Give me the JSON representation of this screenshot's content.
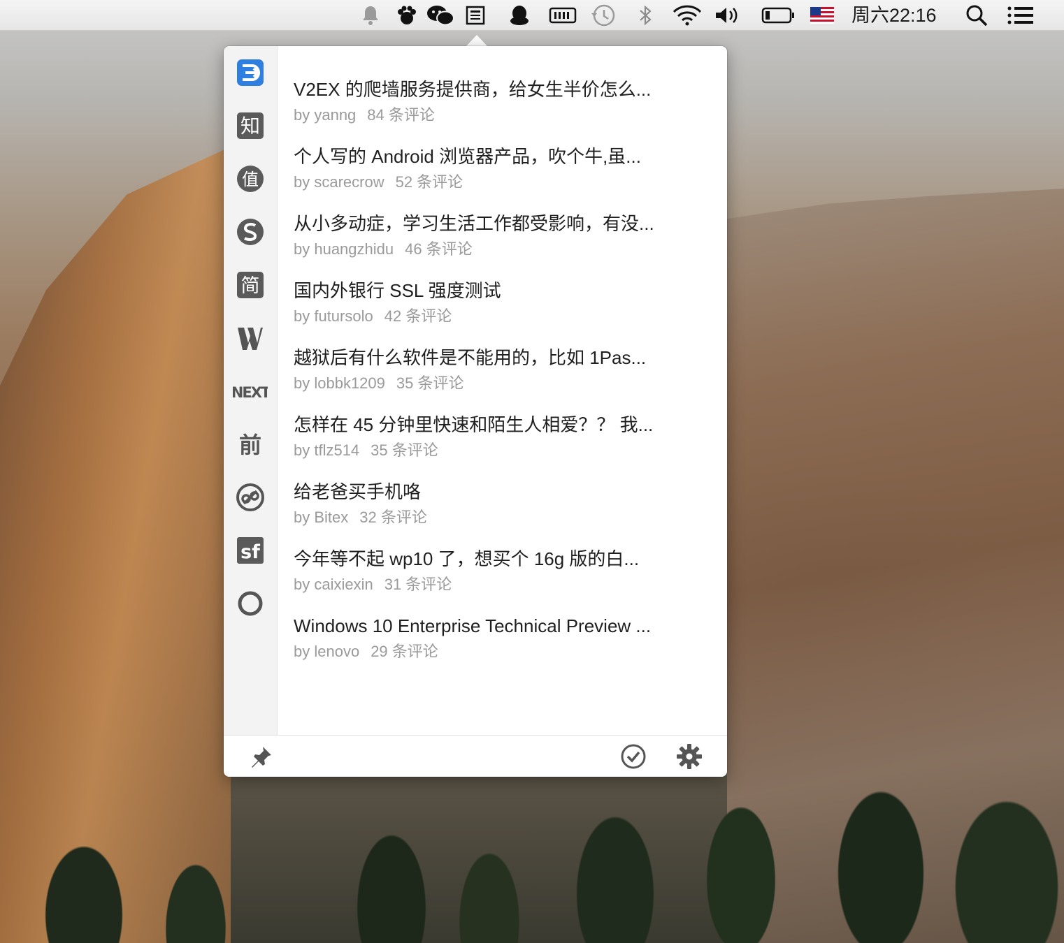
{
  "menubar": {
    "clock": "周六22:16",
    "icons": [
      "bell-icon",
      "paw-icon",
      "wechat-icon",
      "reader-icon",
      "qq-icon",
      "memory-icon",
      "time-machine-icon",
      "bluetooth-icon",
      "wifi-icon",
      "volume-icon",
      "battery-icon",
      "us-flag-icon",
      "spotlight-search-icon",
      "notification-center-icon"
    ]
  },
  "sidebar": {
    "items": [
      {
        "name": "v2ex",
        "icon": "v2ex-icon",
        "active": true
      },
      {
        "name": "zhihu",
        "icon": "zhihu-icon",
        "glyph": "知"
      },
      {
        "name": "smzdm",
        "icon": "zhi-value-icon",
        "glyph": "值"
      },
      {
        "name": "segmentfault-s",
        "icon": "s-circle-icon"
      },
      {
        "name": "jianshu",
        "icon": "jianshu-icon",
        "glyph": "简"
      },
      {
        "name": "w-site",
        "icon": "w-logo-icon"
      },
      {
        "name": "next",
        "icon": "next-logo-icon",
        "glyph": "NEXT"
      },
      {
        "name": "qianxian",
        "icon": "qianxian-icon",
        "glyph": "前"
      },
      {
        "name": "link-site",
        "icon": "link-circle-icon"
      },
      {
        "name": "segmentfault",
        "icon": "sf-icon",
        "glyph": "sf"
      },
      {
        "name": "ring",
        "icon": "ring-icon"
      }
    ]
  },
  "topics": [
    {
      "title": "V2EX 的爬墙服务提供商，给女生半价怎么...",
      "author": "by yanng",
      "comments": "84 条评论"
    },
    {
      "title": "个人写的 Android 浏览器产品，吹个牛,虽...",
      "author": "by scarecrow",
      "comments": "52 条评论"
    },
    {
      "title": "从小多动症，学习生活工作都受影响，有没...",
      "author": "by huangzhidu",
      "comments": "46 条评论"
    },
    {
      "title": "国内外银行 SSL 强度测试",
      "author": "by futursolo",
      "comments": "42 条评论"
    },
    {
      "title": "越狱后有什么软件是不能用的，比如 1Pas...",
      "author": "by lobbk1209",
      "comments": "35 条评论"
    },
    {
      "title": "怎样在 45 分钟里快速和陌生人相爱？？ 我...",
      "author": "by tflz514",
      "comments": "35 条评论"
    },
    {
      "title": "给老爸买手机咯",
      "author": "by Bitex",
      "comments": "32 条评论"
    },
    {
      "title": "今年等不起 wp10 了，想买个 16g 版的白...",
      "author": "by caixiexin",
      "comments": "31 条评论"
    },
    {
      "title": "Windows 10 Enterprise Technical Preview ...",
      "author": "by lenovo",
      "comments": "29 条评论"
    }
  ],
  "footer": {
    "left": [
      "pin-icon"
    ],
    "right": [
      "check-circle-icon",
      "gear-icon"
    ]
  },
  "colors": {
    "accent": "#2f7fe0",
    "icon_gray": "#555555",
    "title_text": "#1f1f1f",
    "meta_text": "#9a9a9a"
  }
}
